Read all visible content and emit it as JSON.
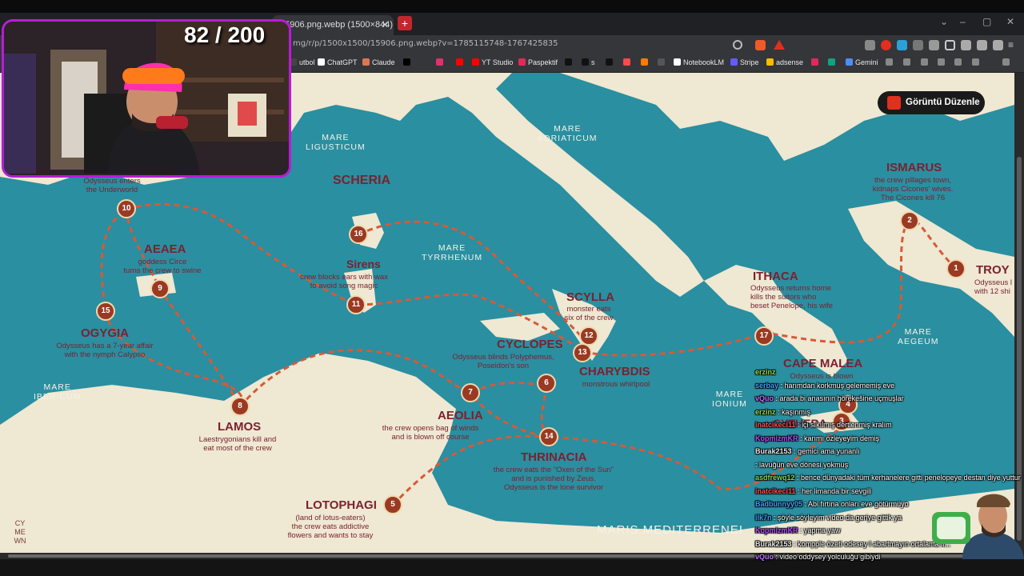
{
  "browser": {
    "tab_title": "15906.png.webp (1500×844)",
    "tab_close": "✕",
    "new_tab": "+",
    "url": "mg/r/p/1500x1500/15906.png.webp?v=1785115748-1767425835",
    "bookmarks": [
      {
        "label": "utbol",
        "color": "#444"
      },
      {
        "label": "ChatGPT",
        "color": "#ffffff"
      },
      {
        "label": "Claude",
        "color": "#d97757"
      },
      {
        "label": "",
        "color": "#000000"
      },
      {
        "label": "",
        "color": "#e1306c"
      },
      {
        "label": "",
        "color": "#ff0000"
      },
      {
        "label": "YT Studio",
        "color": "#ff0000"
      },
      {
        "label": "Paspektif",
        "color": "#e02a5a"
      },
      {
        "label": "",
        "color": "#111111"
      },
      {
        "label": "s",
        "color": "#111111"
      },
      {
        "label": "",
        "color": "#111111"
      },
      {
        "label": "",
        "color": "#ff4b4b"
      },
      {
        "label": "",
        "color": "#ff7a00"
      },
      {
        "label": "",
        "color": "#555555"
      },
      {
        "label": "NotebookLM",
        "color": "#ffffff"
      },
      {
        "label": "Stripe",
        "color": "#635bff"
      },
      {
        "label": "adsense",
        "color": "#fbbc04"
      },
      {
        "label": "",
        "color": "#e02a5a"
      },
      {
        "label": "",
        "color": "#10a37f"
      },
      {
        "label": "Gemini",
        "color": "#4f8df5"
      }
    ]
  },
  "overlay": {
    "counter": "82 / 200",
    "edit_button": "Görüntü Düzenle"
  },
  "map": {
    "seas": [
      {
        "text": "MARE\nLIGUSTICUM"
      },
      {
        "text": "MARE\nADRIATICUM"
      },
      {
        "text": "MARE\nTYRRHENUM"
      },
      {
        "text": "MARE\nIBERICUM"
      },
      {
        "text": "MARE\nIONIUM"
      },
      {
        "text": "MARE\nAEGEUM"
      },
      {
        "text": "MARIS MEDITERRENEI"
      }
    ],
    "places": [
      {
        "name": "SCHERIA",
        "desc": ""
      },
      {
        "name": "ISMARUS",
        "desc": "the crew pillages town,\nkidnaps Cicones' wives.\nThe Cicones kill 76"
      },
      {
        "name": "TROY",
        "desc": "Odysseus l\nwith 12 shi"
      },
      {
        "name": "AEAEA",
        "desc": "goddess Circe\nturns the crew to swine"
      },
      {
        "name": "Sirens",
        "desc": "crew blocks ears with wax\nto avoid song magic"
      },
      {
        "name": "OGYGIA",
        "desc": "Odysseus has a 7-year affair\nwith the nymph Calypso"
      },
      {
        "name": "SCYLLA",
        "desc": "monster eats\nsix of the crew"
      },
      {
        "name": "ITHACA",
        "desc": "Odysseus returns home\nkills the suitors who\nbeset Penelope, his wife"
      },
      {
        "name": "CYCLOPES",
        "desc": "Odysseus blinds Polyphemus,\nPoseidon's son"
      },
      {
        "name": "CHARYBDIS",
        "desc": "monstrous whirlpool"
      },
      {
        "name": "CAPE MALEA",
        "desc": "Odysseus is blown"
      },
      {
        "name": "LAMOS",
        "desc": "Laestrygonians kill and\neat most of the crew"
      },
      {
        "name": "AEOLIA",
        "desc": "the crew opens bag of winds\nand is blown off course"
      },
      {
        "name": "THRINACIA",
        "desc": "the crew eats the \"Oxen of the Sun\"\nand is punished by Zeus.\nOdysseus is the lone survivor"
      },
      {
        "name": "LOTOPHAGI",
        "desc": "(land of lotus-eaters)\nthe crew eats addictive\nflowers and wants to stay"
      },
      {
        "name": "",
        "desc": "Odysseus enters\nthe Underworld"
      },
      {
        "name": "CYTHERA",
        "desc": ""
      }
    ],
    "nodes": [
      "10",
      "16",
      "2",
      "1",
      "9",
      "11",
      "15",
      "12",
      "13",
      "17",
      "6",
      "7",
      "14",
      "8",
      "5",
      "4",
      "3"
    ],
    "signature": "CY\nME\nWN"
  },
  "chat": [
    {
      "user": "erzinz",
      "text": "",
      "color": "#9ad84a"
    },
    {
      "user": "serbay",
      "text": "harımdan korkmuş gelememiş eve",
      "color": "#3da0ff"
    },
    {
      "user": "vQuo",
      "text": "arada bi anasının hörekešine uçmuşlar",
      "color": "#c36bff"
    },
    {
      "user": "erzinz",
      "text": "kaşınmış",
      "color": "#9ad84a"
    },
    {
      "user": "inatcikeci11",
      "text": "içi sıkılmış dertlenmiş kralım",
      "color": "#ff4f4f"
    },
    {
      "user": "KopmizmKR",
      "text": "karımı özleyeyim demiş",
      "color": "#b44cff"
    },
    {
      "user": "Burak2153",
      "text": "gemici ama yunanlı",
      "color": "#e8e8e8"
    },
    {
      "user": "",
      "text": "lavuğun eve dönesi yokmuş",
      "color": "#c36bff"
    },
    {
      "user": "asdfrewq12",
      "text": "bence dünyadaki tüm kerhanelere gitti penelopeye destan diye yuttur",
      "color": "#7fd35a"
    },
    {
      "user": "inatcikeci11",
      "text": "her limanda bir sevgili",
      "color": "#ff4f4f"
    },
    {
      "user": "Badbunnyy05",
      "text": "Abi fırtına onları eve götürmüyo",
      "color": "#3da0ff"
    },
    {
      "user": "ilk7n",
      "text": "şöyle söyleyim video da geriye gittik ya",
      "color": "#3da0ff"
    },
    {
      "user": "KopmizmKR",
      "text": "yapma yaw",
      "color": "#b44cff"
    },
    {
      "user": "Burak2153",
      "text": "kompple özeti odesey l abartmayın ortalama fi...",
      "color": "#e8e8e8"
    },
    {
      "user": "vQuo",
      "text": "video oddysey yolculuğu gibiydi",
      "color": "#c36bff"
    }
  ]
}
